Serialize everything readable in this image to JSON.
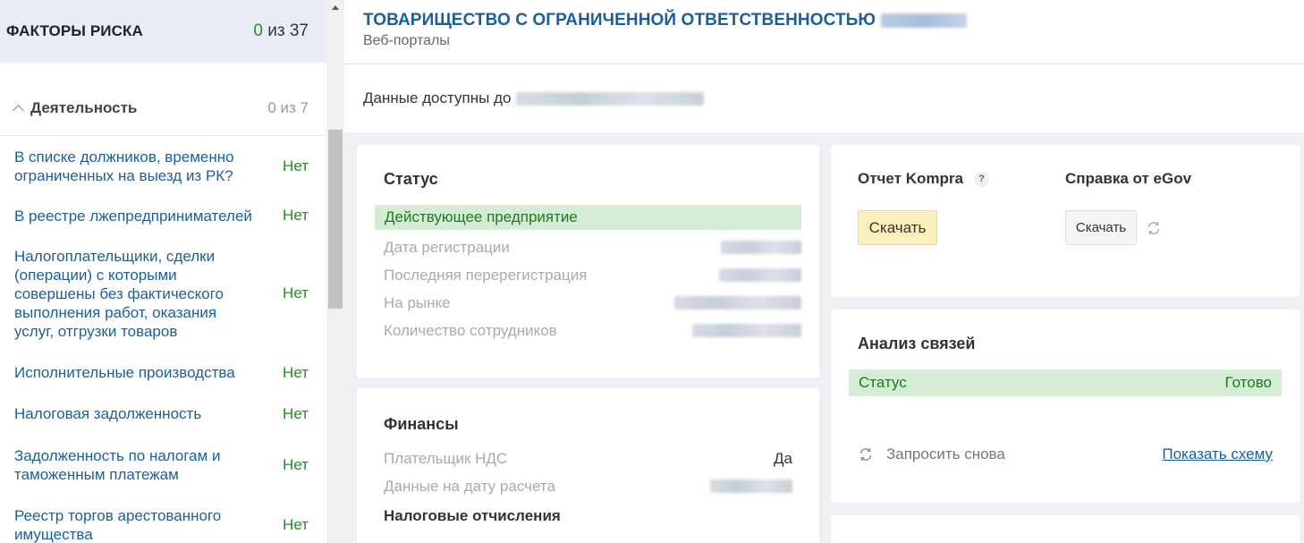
{
  "sidebar": {
    "title": "ФАКТОРЫ РИСКА",
    "count_found": "0",
    "count_total": "из 37",
    "section": {
      "title": "Деятельность",
      "count": "0 из 7"
    },
    "items": [
      {
        "label": "В списке должников, временно ограниченных на выезд из РК?",
        "value": "Нет"
      },
      {
        "label": "В реестре лжепредпринимателей",
        "value": "Нет"
      },
      {
        "label": "Налогоплательщики, сделки (операции) с которыми совершены без фактического выполнения работ, оказания услуг, отгрузки товаров",
        "value": "Нет"
      },
      {
        "label": "Исполнительные производства",
        "value": "Нет"
      },
      {
        "label": "Налоговая задолженность",
        "value": "Нет"
      },
      {
        "label": "Задолженность по налогам и таможенным платежам",
        "value": "Нет"
      },
      {
        "label": "Реестр торгов арестованного имущества",
        "value": "Нет"
      }
    ]
  },
  "header": {
    "company_name": "ТОВАРИЩЕСТВО С ОГРАНИЧЕННОЙ ОТВЕТСТВЕННОСТЬЮ",
    "subtitle": "Веб-порталы",
    "availability": "Данные доступны до"
  },
  "status_card": {
    "title": "Статус",
    "state": "Действующее предприятие",
    "rows": [
      {
        "label": "Дата регистрации"
      },
      {
        "label": "Последняя перерегистрация"
      },
      {
        "label": "На рынке"
      },
      {
        "label": "Количество сотрудников"
      }
    ]
  },
  "finance_card": {
    "title": "Финансы",
    "vat_label": "Плательщик НДС",
    "vat_value": "Да",
    "calc_date_label": "Данные на дату расчета",
    "taxes_heading": "Налоговые отчисления"
  },
  "report_card": {
    "kompra_label": "Отчет Kompra",
    "help": "?",
    "kompra_button": "Скачать",
    "egov_label": "Справка от eGov",
    "egov_button": "Скачать"
  },
  "relations_card": {
    "title": "Анализ связей",
    "status_label": "Статус",
    "status_value": "Готово",
    "retry_label": "Запросить снова",
    "show_link": "Показать схему"
  },
  "colors": {
    "accent_blue": "#1a5f9c",
    "success_green": "#2a8a2a",
    "success_bg": "#d4ecd4",
    "button_yellow": "#fcefbe"
  },
  "icons": [
    "chevron-up-icon",
    "help-icon",
    "refresh-icon",
    "scroll-up-arrow-icon"
  ]
}
